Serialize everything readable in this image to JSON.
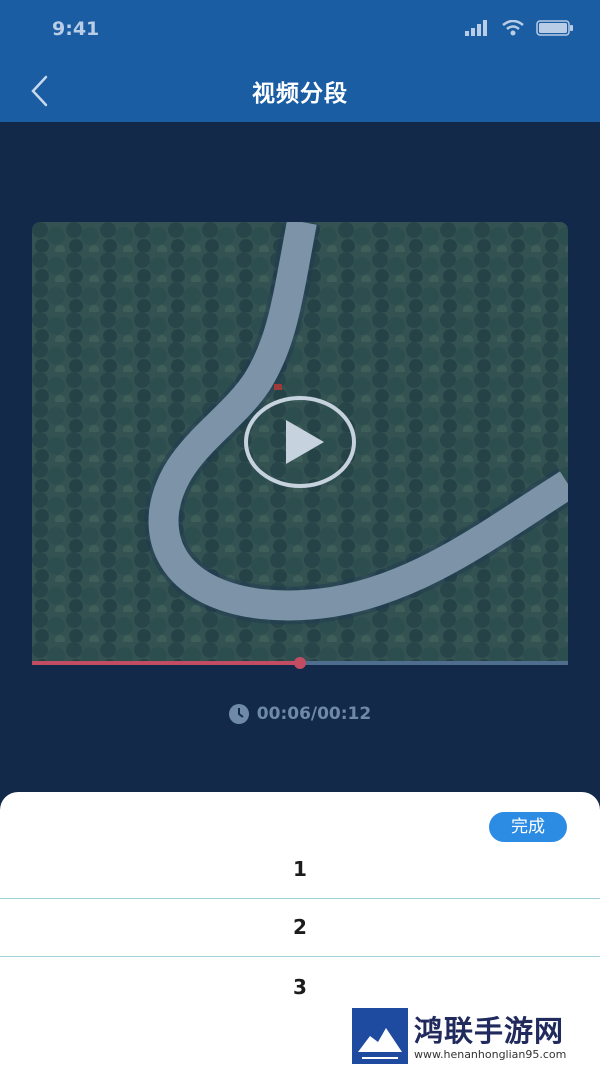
{
  "status_bar": {
    "time": "9:41"
  },
  "header": {
    "title": "视频分段"
  },
  "video": {
    "current_time": "00:06",
    "total_time": "00:12",
    "time_text": "00:06/00:12",
    "progress": 0.5
  },
  "sheet": {
    "done_label": "完成",
    "options": [
      "1",
      "2",
      "3"
    ]
  },
  "watermark": {
    "title": "鸿联手游网",
    "url": "www.henanhonglian95.com"
  },
  "colors": {
    "header_bg": "#1a5da3",
    "page_bg": "#13294a",
    "accent": "#2c8be3",
    "progress_fill": "#c24d63",
    "divider": "#9fd3dc"
  },
  "icons": [
    "back-arrow-icon",
    "signal-icon",
    "wifi-icon",
    "battery-icon",
    "play-icon",
    "clock-icon"
  ]
}
